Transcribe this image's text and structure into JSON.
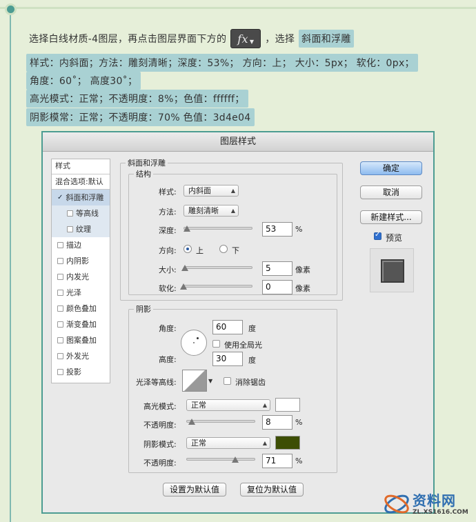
{
  "instructions": {
    "line1_prefix": "选择白线材质-4图层，再点击图层界面下方的",
    "fx_label": "fx",
    "line1_mid": "，选择",
    "line1_highlight": "斜面和浮雕",
    "line2": "样式：内斜面；方法：雕刻清晰；深度：53%；  方向：上；  大小：5px；  软化：0px；",
    "line3": "角度：60˚；  高度30˚；",
    "line4": "高光模式：正常；不透明度：8%；色值：ffffff；",
    "line5": "阴影模常：正常；不透明度：70%  色值：3d4e04"
  },
  "dialog": {
    "title": "图层样式",
    "style_list": {
      "header": "样式",
      "blend_options": "混合选项:默认",
      "items": [
        {
          "label": "斜面和浮雕",
          "checked": true,
          "active": true,
          "sub": false
        },
        {
          "label": "等高线",
          "checked": false,
          "active": false,
          "sub": true
        },
        {
          "label": "纹理",
          "checked": false,
          "active": false,
          "sub": true
        },
        {
          "label": "描边",
          "checked": false,
          "active": false,
          "sub": false
        },
        {
          "label": "内阴影",
          "checked": false,
          "active": false,
          "sub": false
        },
        {
          "label": "内发光",
          "checked": false,
          "active": false,
          "sub": false
        },
        {
          "label": "光泽",
          "checked": false,
          "active": false,
          "sub": false
        },
        {
          "label": "颜色叠加",
          "checked": false,
          "active": false,
          "sub": false
        },
        {
          "label": "渐变叠加",
          "checked": false,
          "active": false,
          "sub": false
        },
        {
          "label": "图案叠加",
          "checked": false,
          "active": false,
          "sub": false
        },
        {
          "label": "外发光",
          "checked": false,
          "active": false,
          "sub": false
        },
        {
          "label": "投影",
          "checked": false,
          "active": false,
          "sub": false
        }
      ]
    },
    "bevel": {
      "group_title": "斜面和浮雕",
      "structure_title": "结构",
      "style_label": "样式:",
      "style_value": "内斜面",
      "technique_label": "方法:",
      "technique_value": "雕刻清晰",
      "depth_label": "深度:",
      "depth_value": "53",
      "depth_unit": "%",
      "direction_label": "方向:",
      "direction_up": "上",
      "direction_down": "下",
      "size_label": "大小:",
      "size_value": "5",
      "size_unit": "像素",
      "soften_label": "软化:",
      "soften_value": "0",
      "soften_unit": "像素",
      "depth_slider_fraction": 0.05,
      "size_slider_fraction": 0.02,
      "soften_slider_fraction": 0.0
    },
    "shading": {
      "title": "阴影",
      "angle_label": "角度:",
      "angle_value": "60",
      "angle_unit": "度",
      "global_light_label": "使用全局光",
      "altitude_label": "高度:",
      "altitude_value": "30",
      "altitude_unit": "度",
      "gloss_label": "光泽等高线:",
      "anti_alias_label": "消除锯齿",
      "highlight_mode_label": "高光模式:",
      "highlight_mode_value": "正常",
      "highlight_color": "#ffffff",
      "highlight_opacity_label": "不透明度:",
      "highlight_opacity_value": "8",
      "highlight_opacity_unit": "%",
      "shadow_mode_label": "阴影模式:",
      "shadow_mode_value": "正常",
      "shadow_color": "#3d4e04",
      "shadow_opacity_label": "不透明度:",
      "shadow_opacity_value": "71",
      "shadow_opacity_unit": "%",
      "highlight_slider_fraction": 0.08,
      "shadow_slider_fraction": 0.71
    },
    "buttons": {
      "ok": "确定",
      "cancel": "取消",
      "new_style": "新建样式...",
      "preview_label": "预览",
      "make_default": "设置为默认值",
      "reset_default": "复位为默认值"
    }
  },
  "watermark": {
    "text": "资料网",
    "url": "ZL.XS1616.COM"
  }
}
